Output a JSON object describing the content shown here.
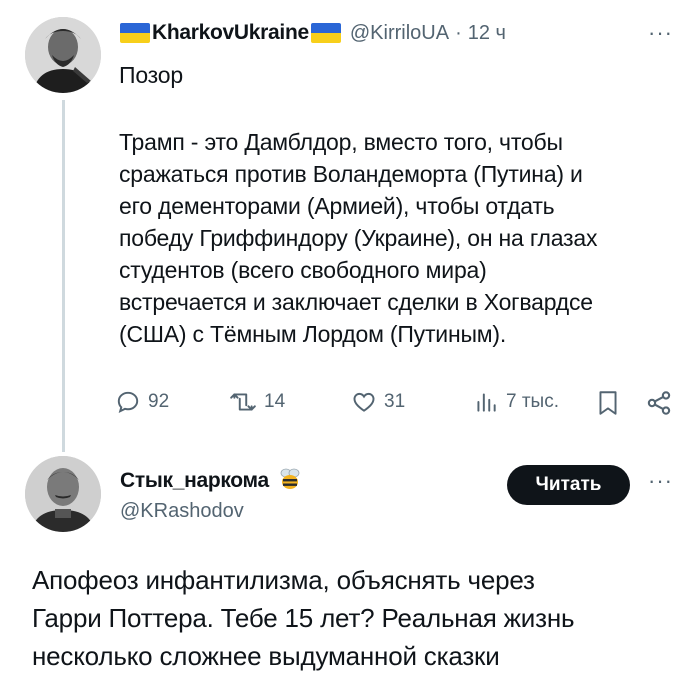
{
  "tweet1": {
    "author_name": "KharkovUkraine",
    "handle": "@KirriloUA",
    "separator": "·",
    "time": "12 ч",
    "more_label": "···",
    "first_line": "Позор",
    "body_lines": [
      "Трамп - это Дамблдор, вместо того, чтобы",
      "сражаться против Воландеморта (Путина) и",
      "его дементорами (Армией), чтобы отдать",
      "победу Гриффиндору (Украине), он на глазах",
      "студентов (всего свободного мира)",
      "встречается и заключает сделки в Хогвардсе",
      "(США) с Тёмным Лордом (Путиным)."
    ],
    "stats": {
      "replies": "92",
      "retweets": "14",
      "likes": "31",
      "views": "7 тыс."
    },
    "flag_colors": {
      "top": "#2a66d6",
      "bottom": "#f7cf1b"
    }
  },
  "tweet2": {
    "author_name": "Стык_наркома",
    "name_emoji": "bee-icon",
    "handle": "@KRashodov",
    "follow_label": "Читать",
    "more_label": "···",
    "body_lines": [
      "Апофеоз инфантилизма, объяснять через",
      "Гарри Поттера. Тебе 15 лет? Реальная жизнь",
      "несколько сложнее выдуманной сказки"
    ]
  },
  "colors": {
    "text": "#0f1419",
    "muted": "#536471",
    "thread_line": "#cfd9de",
    "button_bg": "#0f1419"
  },
  "icons": [
    "reply-icon",
    "retweet-icon",
    "like-icon",
    "views-icon",
    "bookmark-icon",
    "share-icon"
  ]
}
